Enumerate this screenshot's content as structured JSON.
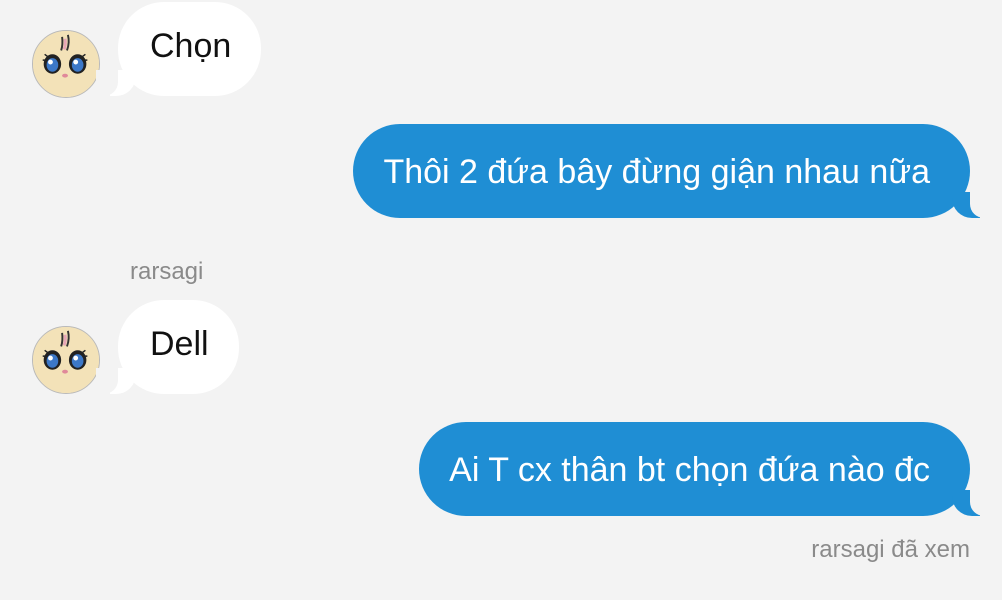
{
  "colors": {
    "background": "#f3f3f3",
    "incoming_bubble": "#ffffff",
    "outgoing_bubble": "#1f8ed4",
    "meta_text": "#8a8a8a"
  },
  "avatar_icon": "cartoon-face-icon",
  "messages": [
    {
      "direction": "incoming",
      "text": "Chọn"
    },
    {
      "direction": "outgoing",
      "text": "Thôi 2 đứa bây đừng giận nhau nữa"
    },
    {
      "sender": "rarsagi"
    },
    {
      "direction": "incoming",
      "text": "Dell"
    },
    {
      "direction": "outgoing",
      "text": "Ai T cx thân bt chọn đứa nào đc"
    }
  ],
  "seen_status": "rarsagi đã xem"
}
